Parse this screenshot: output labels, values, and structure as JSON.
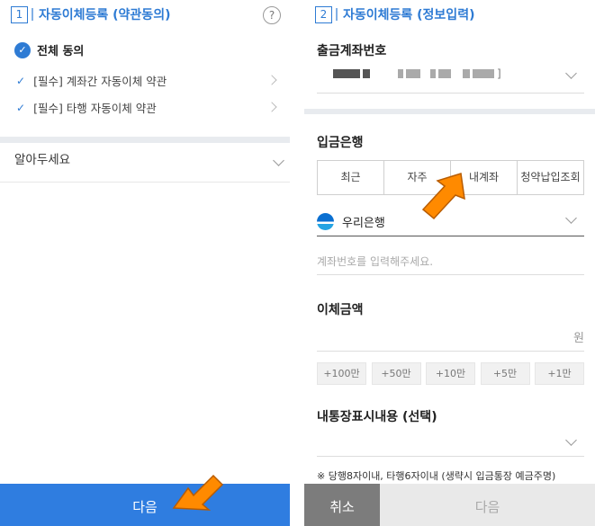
{
  "left": {
    "step_number": "1",
    "step_title": "자동이체등록 (약관동의)",
    "help_icon": "?",
    "agree_all": "전체 동의",
    "terms": [
      {
        "label": "[필수] 계좌간 자동이체 약관"
      },
      {
        "label": "[필수] 타행 자동이체 약관"
      }
    ],
    "notice": "알아두세요",
    "next_button": "다음"
  },
  "right": {
    "step_number": "2",
    "step_title": "자동이체등록 (정보입력)",
    "withdraw_label": "출금계좌번호",
    "withdraw_suffix": "]",
    "deposit_bank_label": "입금은행",
    "tabs": [
      "최근",
      "자주",
      "내계좌",
      "청약납입조회"
    ],
    "bank_name": "우리은행",
    "account_placeholder": "계좌번호를 입력해주세요.",
    "amount_label": "이체금액",
    "amount_unit": "원",
    "quick_amounts": [
      "+100만",
      "+50만",
      "+10만",
      "+5만",
      "+1만"
    ],
    "memo_label": "내통장표시내용 (선택)",
    "memo_note": "※ 당행8자이내, 타행6자이내 (생략시 입금통장 예금주명)",
    "cancel_button": "취소",
    "next_button": "다음"
  },
  "colors": {
    "accent": "#2e7bd4",
    "primary_button": "#2f7de0",
    "cancel_button": "#7c7c7c",
    "disabled_button": "#e9e9e9",
    "arrow": "#ff8a00"
  },
  "icons": [
    "help-icon",
    "check-circle-icon",
    "checkmark-icon",
    "chevron-right-icon",
    "chevron-down-icon",
    "woori-bank-logo-icon",
    "pointer-arrow-icon"
  ]
}
